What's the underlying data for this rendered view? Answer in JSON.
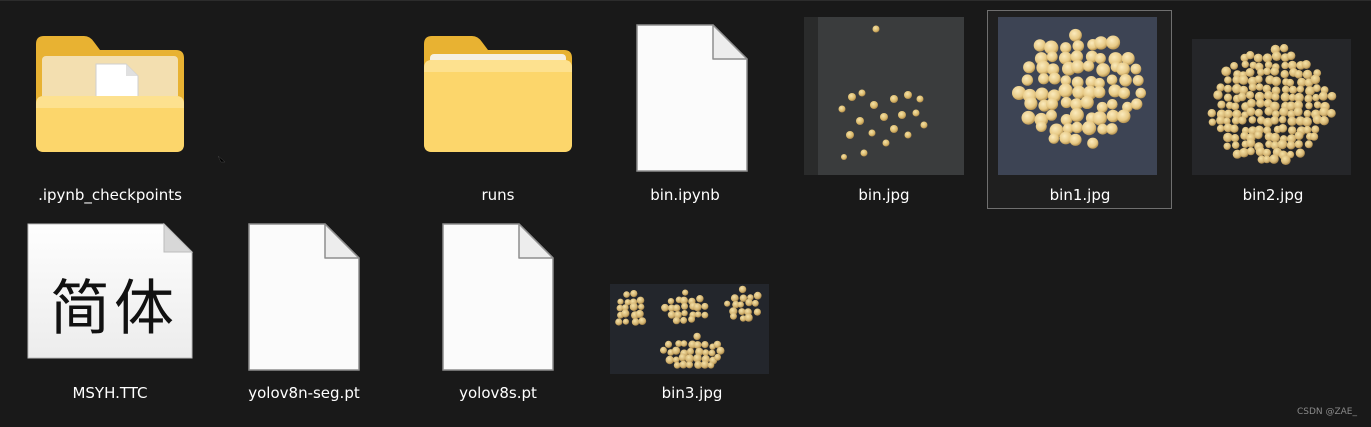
{
  "files": [
    {
      "name": ".ipynb_checkpoints",
      "type": "folder-with-doc"
    },
    {
      "name": "runs",
      "type": "folder"
    },
    {
      "name": "bin.ipynb",
      "type": "file"
    },
    {
      "name": "bin.jpg",
      "type": "image"
    },
    {
      "name": "bin1.jpg",
      "type": "image",
      "selected": true
    },
    {
      "name": "bin2.jpg",
      "type": "image"
    },
    {
      "name": "MSYH.TTC",
      "type": "font",
      "preview": "简体"
    },
    {
      "name": "yolov8n-seg.pt",
      "type": "file"
    },
    {
      "name": "yolov8s.pt",
      "type": "file"
    },
    {
      "name": "bin3.jpg",
      "type": "image"
    }
  ],
  "watermark": "CSDN @ZAE_"
}
